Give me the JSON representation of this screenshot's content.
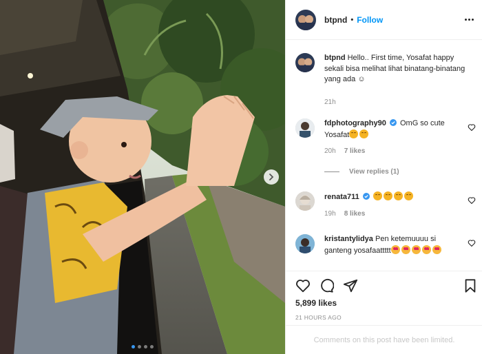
{
  "post": {
    "author": "btpnd",
    "separator": "•",
    "follow_label": "Follow",
    "more_icon": "more-options-icon",
    "caption": "Hello.. First time, Yosafat happy sekali bisa melihat lihat binatang-binatang yang ada ☺",
    "caption_age": "21h",
    "likes": "5,899 likes",
    "posted": "21 HOURS AGO",
    "comments_limited": "Comments on this post have been limited.",
    "carousel_slides": 4,
    "carousel_active": 1
  },
  "comments": [
    {
      "user": "fdphotography90",
      "verified": true,
      "text": "OmG so cute Yosafat",
      "emoji_count": 2,
      "emoji": "smiling-face-icon",
      "age": "20h",
      "likes": "7 likes",
      "replies": "View replies (1)"
    },
    {
      "user": "renata711",
      "verified": true,
      "text": "",
      "emoji_count": 4,
      "emoji": "smiling-face-icon",
      "age": "19h",
      "likes": "8 likes"
    },
    {
      "user": "kristantylidya",
      "verified": false,
      "text": "Pen ketemuuuu si ganteng yosafaattttt",
      "emoji_count": 5,
      "emoji": "heart-eyes-face-icon"
    }
  ],
  "icons": [
    "heart-icon",
    "comment-icon",
    "share-icon",
    "bookmark-icon",
    "chevron-right-icon",
    "verified-badge-icon"
  ],
  "colors": {
    "accent": "#0095f6",
    "text": "#262626",
    "muted": "#8e8e8e",
    "verified": "#3897f0",
    "active_dot": "#3897f0"
  }
}
